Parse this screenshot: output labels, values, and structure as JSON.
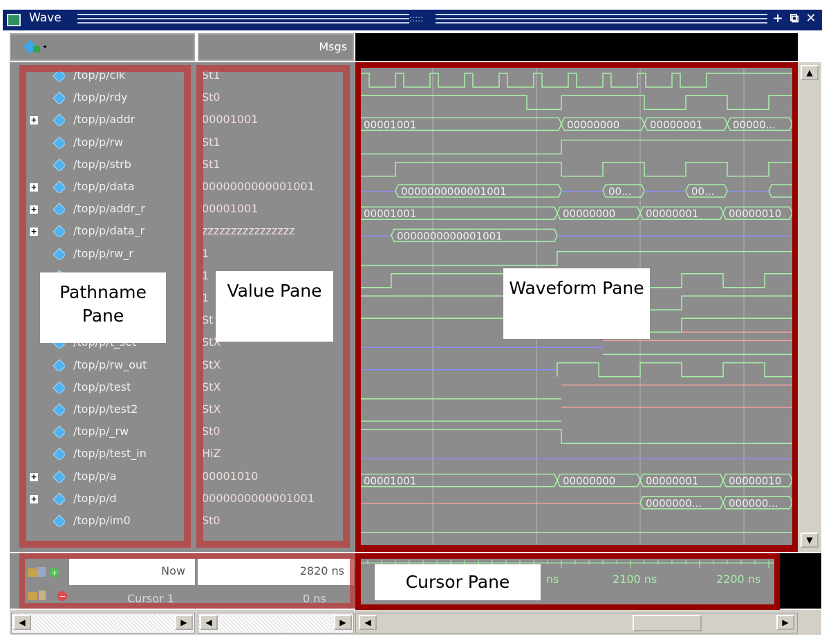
{
  "window": {
    "title": "Wave"
  },
  "toolbar": {
    "msgs_label": "Msgs"
  },
  "signals": [
    {
      "path": "/top/p/clk",
      "value": "St1",
      "expandable": false
    },
    {
      "path": "/top/p/rdy",
      "value": "St0",
      "expandable": false
    },
    {
      "path": "/top/p/addr",
      "value": "00001001",
      "expandable": true
    },
    {
      "path": "/top/p/rw",
      "value": "St1",
      "expandable": false
    },
    {
      "path": "/top/p/strb",
      "value": "St1",
      "expandable": false
    },
    {
      "path": "/top/p/data",
      "value": "0000000000001001",
      "expandable": true
    },
    {
      "path": "/top/p/addr_r",
      "value": "00001001",
      "expandable": true
    },
    {
      "path": "/top/p/data_r",
      "value": "zzzzzzzzzzzzzzzz",
      "expandable": true
    },
    {
      "path": "/top/p/rw_r",
      "value": "1",
      "expandable": false
    },
    {
      "path": "",
      "value": "1",
      "expandable": false
    },
    {
      "path": "",
      "value": "1",
      "expandable": false
    },
    {
      "path": "",
      "value": "St",
      "expandable": false
    },
    {
      "path": "/top/p/t_set",
      "value": "StX",
      "expandable": false
    },
    {
      "path": "/top/p/rw_out",
      "value": "StX",
      "expandable": false
    },
    {
      "path": "/top/p/test",
      "value": "StX",
      "expandable": false
    },
    {
      "path": "/top/p/test2",
      "value": "StX",
      "expandable": false
    },
    {
      "path": "/top/p/_rw",
      "value": "St0",
      "expandable": false
    },
    {
      "path": "/top/p/test_in",
      "value": "HiZ",
      "expandable": false
    },
    {
      "path": "/top/p/a",
      "value": "00001010",
      "expandable": true
    },
    {
      "path": "/top/p/d",
      "value": "0000000000001001",
      "expandable": true
    },
    {
      "path": "/top/p/im0",
      "value": "St0",
      "expandable": false
    }
  ],
  "wave_labels": {
    "addr": [
      "00001001",
      "00000000",
      "00000001",
      "00000..."
    ],
    "data": [
      "0000000000001001",
      "00...",
      "00..."
    ],
    "addr_r": [
      "00001001",
      "00000000",
      "00000001",
      "00000010"
    ],
    "data_r": [
      "0000000000001001"
    ],
    "a": [
      "00001001",
      "00000000",
      "00000001",
      "00000010"
    ],
    "d": [
      "0000000...",
      "000000..."
    ]
  },
  "cursor": {
    "now_label": "Now",
    "now_value": "2820 ns",
    "cursor_label": "Cursor 1",
    "cursor_value": "0 ns",
    "ticks": [
      "ns",
      "2100 ns",
      "2200 ns"
    ]
  },
  "annotations": {
    "pathname": "Pathname Pane",
    "value": "Value Pane",
    "waveform": "Waveform Pane",
    "cursor": "Cursor Pane"
  },
  "colors": {
    "highlight": "#be3c3c",
    "wave_frame": "#990000",
    "wave_green": "#a8f0a8",
    "wave_blue": "#8c8cff",
    "wave_red": "#f0a0a0"
  }
}
